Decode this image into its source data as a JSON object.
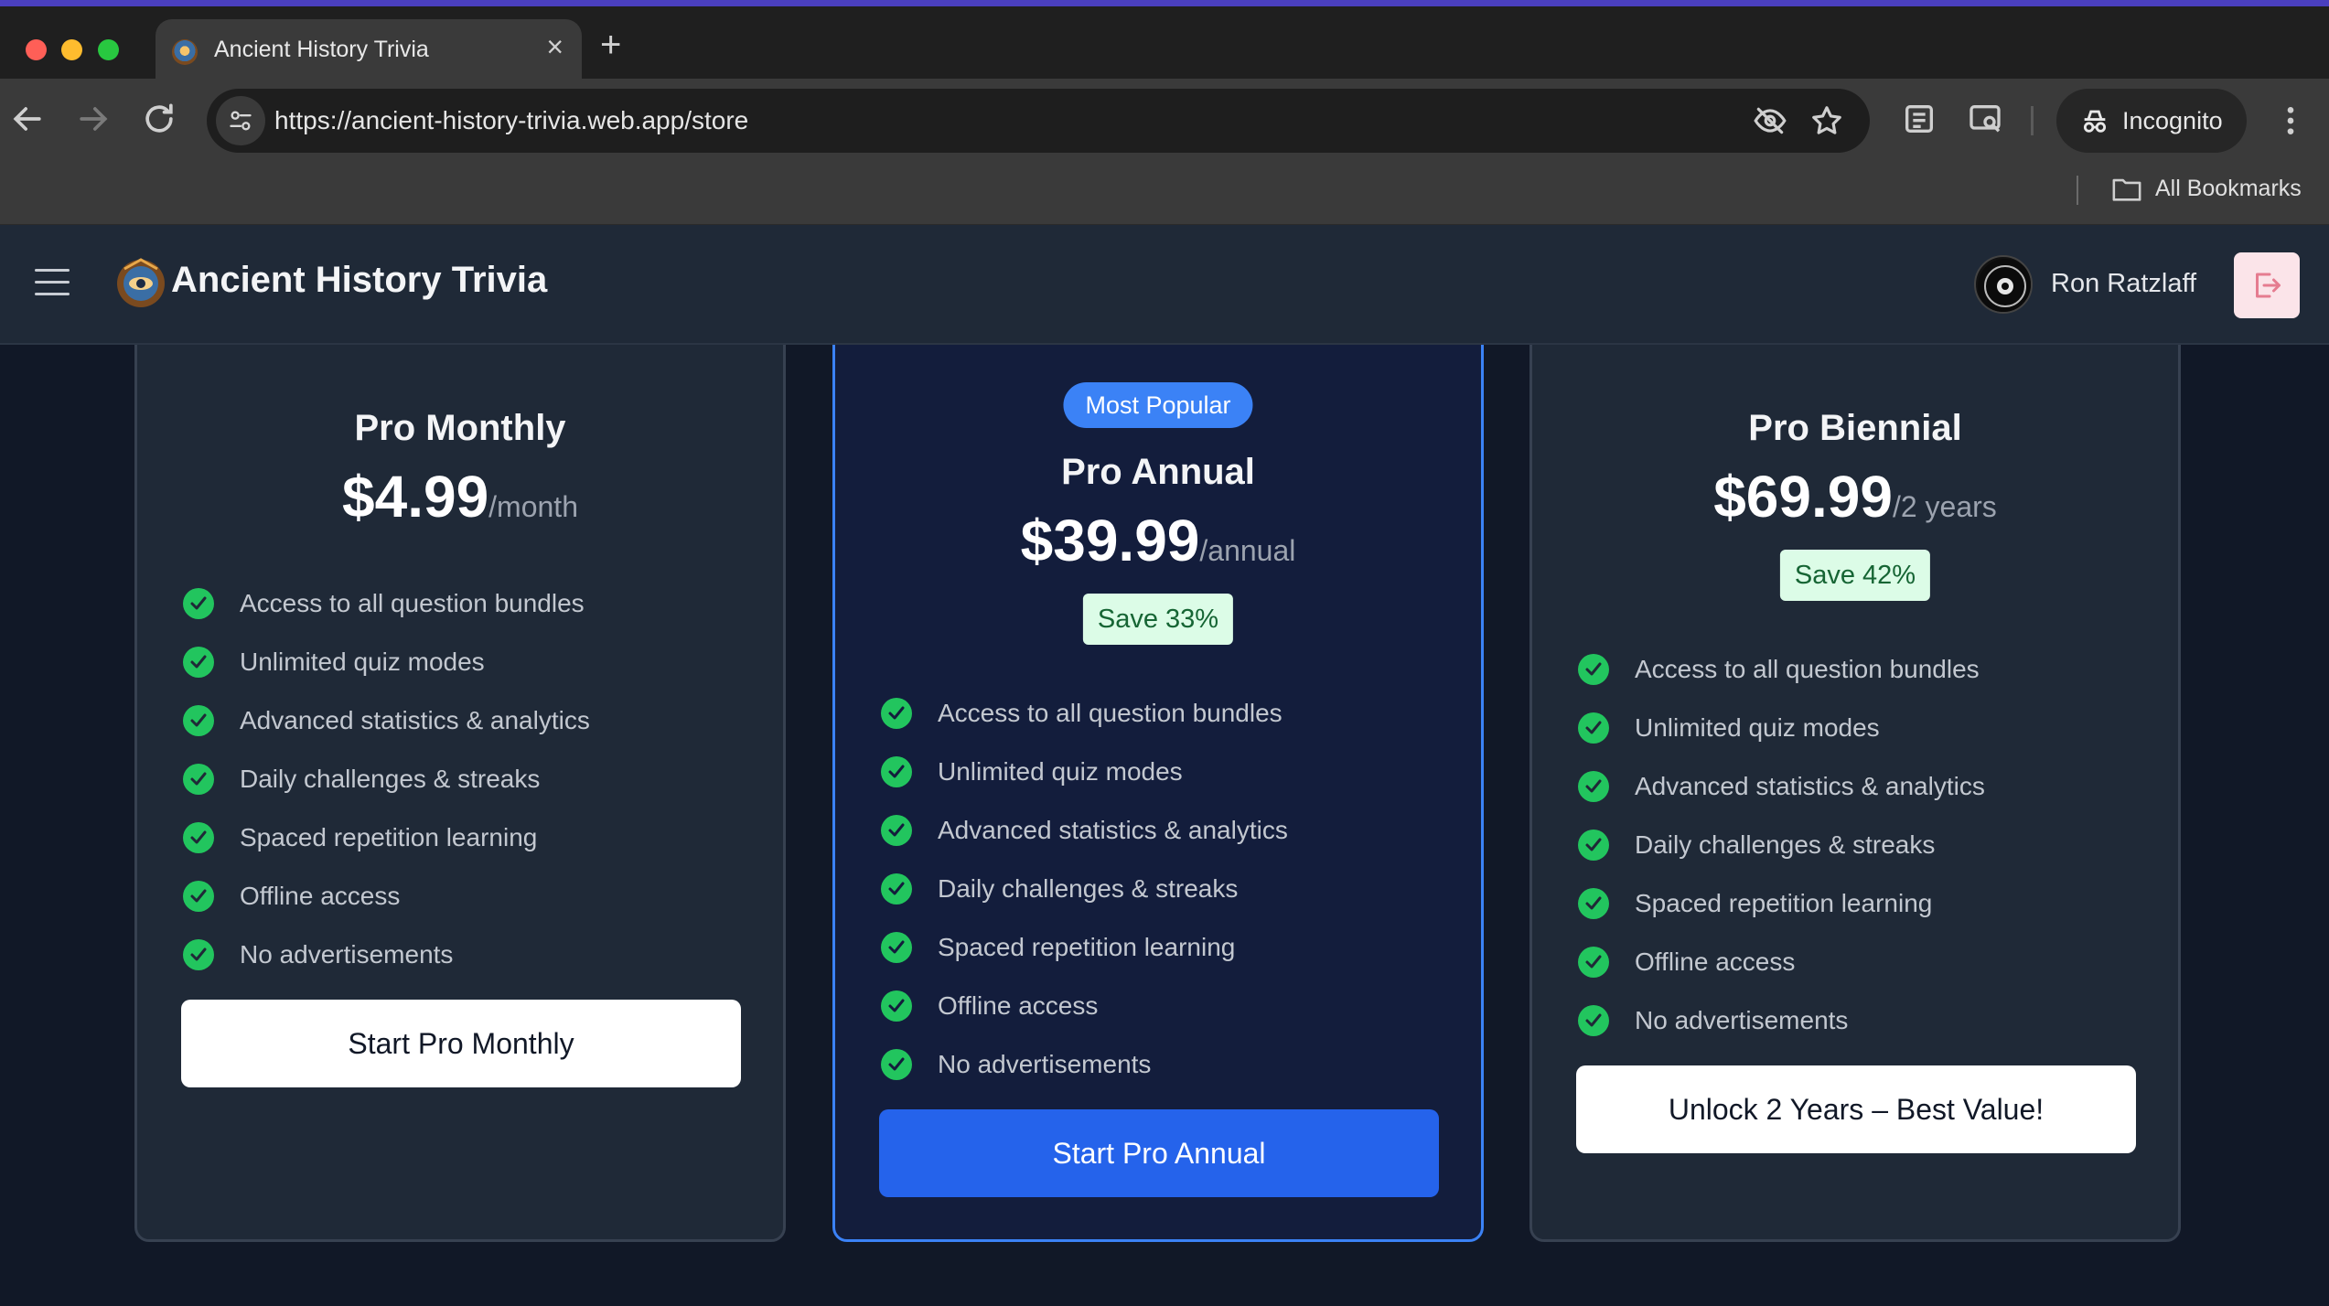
{
  "browser": {
    "tab_title": "Ancient History Trivia",
    "url": "https://ancient-history-trivia.web.app/store",
    "profile_label": "Incognito",
    "bookmarks_label": "All Bookmarks"
  },
  "header": {
    "app_title": "Ancient History Trivia",
    "user_name": "Ron Ratzlaff"
  },
  "plans": [
    {
      "name": "Pro Monthly",
      "price": "$4.99",
      "period": "/month",
      "features": [
        "Access to all question bundles",
        "Unlimited quiz modes",
        "Advanced statistics & analytics",
        "Daily challenges & streaks",
        "Spaced repetition learning",
        "Offline access",
        "No advertisements"
      ],
      "cta": "Start Pro Monthly"
    },
    {
      "badge": "Most Popular",
      "name": "Pro Annual",
      "price": "$39.99",
      "period": "/annual",
      "save": "Save 33%",
      "features": [
        "Access to all question bundles",
        "Unlimited quiz modes",
        "Advanced statistics & analytics",
        "Daily challenges & streaks",
        "Spaced repetition learning",
        "Offline access",
        "No advertisements"
      ],
      "cta": "Start Pro Annual"
    },
    {
      "name": "Pro Biennial",
      "price": "$69.99",
      "period": "/2 years",
      "save": "Save 42%",
      "features": [
        "Access to all question bundles",
        "Unlimited quiz modes",
        "Advanced statistics & analytics",
        "Daily challenges & streaks",
        "Spaced repetition learning",
        "Offline access",
        "No advertisements"
      ],
      "cta": "Unlock 2 Years – Best Value!"
    }
  ],
  "colors": {
    "accent": "#3b82f6",
    "primary_button": "#2563eb",
    "check": "#22c55e",
    "save_bg": "#dcfce7",
    "save_text": "#166534",
    "page_bg": "#111827",
    "card_bg": "#1f2937"
  },
  "icons": {
    "menu": "hamburger-icon",
    "logout": "logout-icon",
    "check": "check-circle-icon",
    "tracking": "eye-off-icon",
    "bookmark": "star-icon",
    "folder": "folder-icon"
  }
}
